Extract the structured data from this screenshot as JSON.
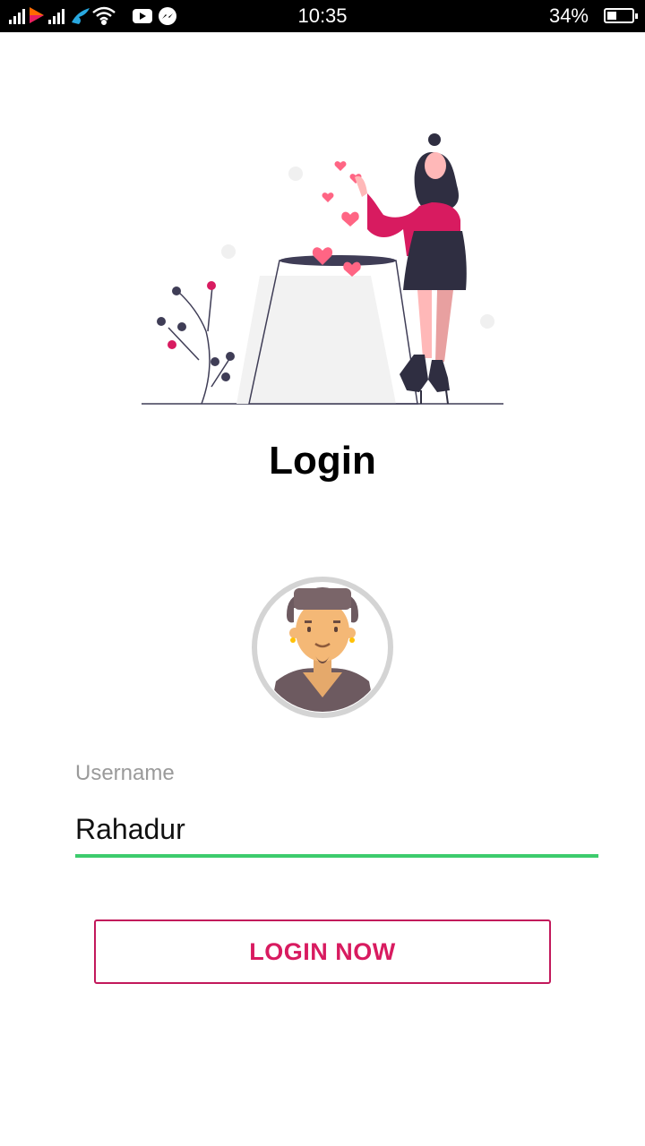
{
  "status_bar": {
    "time": "10:35",
    "battery_percent": "34%",
    "battery_level": 0.34,
    "icons": [
      "signal-icon",
      "app-notification-icon",
      "signal-icon",
      "operator-icon",
      "wifi-icon",
      "youtube-icon",
      "messenger-icon",
      "battery-icon"
    ]
  },
  "colors": {
    "accent_pink": "#d81b60",
    "underline_green": "#3dcc6d",
    "label_gray": "#9a9a9a"
  },
  "page": {
    "title": "Login"
  },
  "form": {
    "username_label": "Username",
    "username_value": "Rahadur"
  },
  "actions": {
    "login_label": "LOGIN NOW"
  }
}
